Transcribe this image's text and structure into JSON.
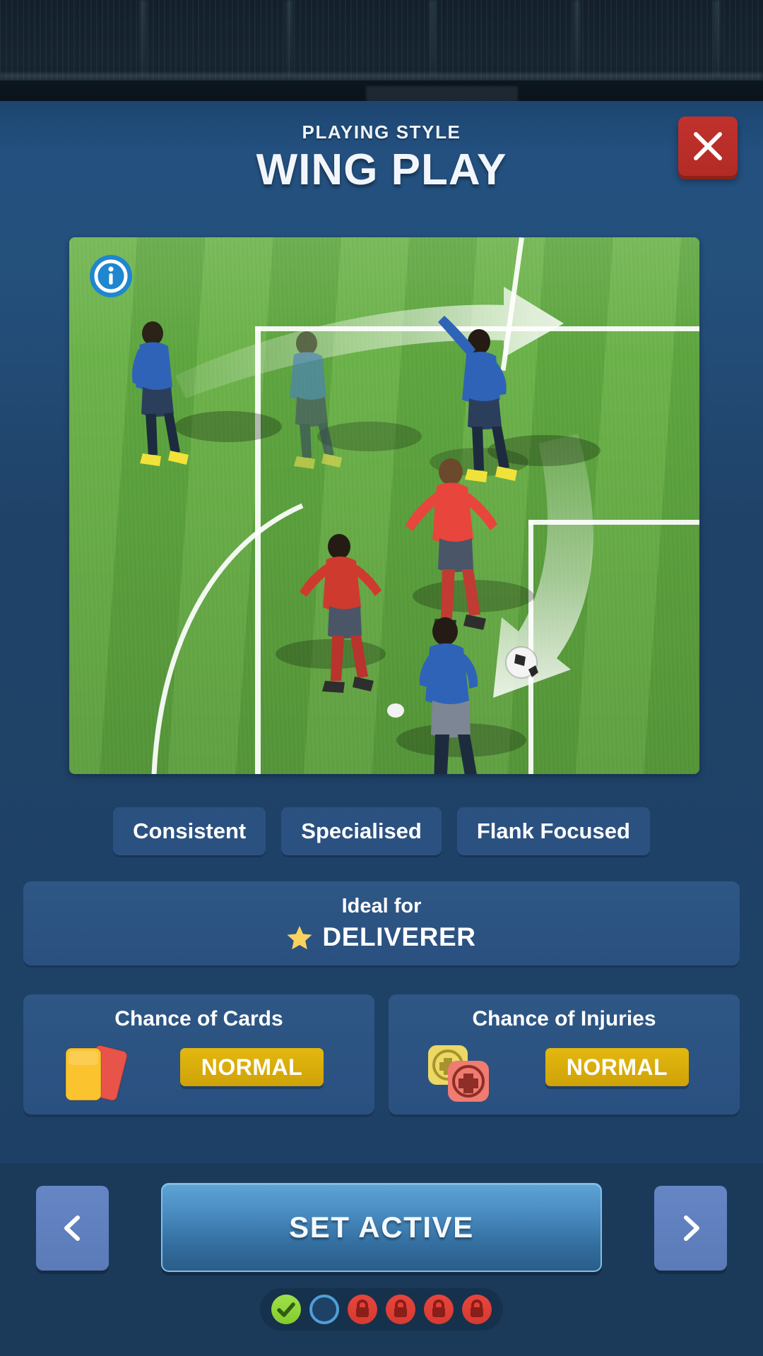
{
  "header": {
    "kicker": "PLAYING STYLE",
    "title": "WING PLAY",
    "close_icon": "close-icon"
  },
  "preview": {
    "info_icon": "info-icon",
    "alt": "wing play tactic pitch animation"
  },
  "tags": [
    {
      "label": "Consistent"
    },
    {
      "label": "Specialised"
    },
    {
      "label": "Flank Focused"
    }
  ],
  "ideal_for": {
    "label": "Ideal for",
    "star_icon": "star-icon",
    "role": "DELIVERER"
  },
  "stats": [
    {
      "title": "Chance of Cards",
      "icon": "cards-icon",
      "value": "NORMAL"
    },
    {
      "title": "Chance of Injuries",
      "icon": "injury-icon",
      "value": "NORMAL"
    }
  ],
  "footer": {
    "prev_icon": "chevron-left-icon",
    "next_icon": "chevron-right-icon",
    "primary_action": "SET ACTIVE",
    "pager": [
      {
        "state": "done",
        "icon": "check-icon"
      },
      {
        "state": "current",
        "icon": "ring-icon"
      },
      {
        "state": "locked",
        "icon": "lock-icon"
      },
      {
        "state": "locked",
        "icon": "lock-icon"
      },
      {
        "state": "locked",
        "icon": "lock-icon"
      },
      {
        "state": "locked",
        "icon": "lock-icon"
      }
    ]
  },
  "colors": {
    "panel_bg": "#1f4268",
    "card_bg": "#2c5382",
    "chip_bg": "#2b5180",
    "accent_gold": "#e3b80f",
    "close_red": "#c1312c",
    "primary_blue": "#4b8ec4",
    "bottom_bar": "#1b3a5a",
    "locked_red": "#e8453c",
    "done_green": "#8fd63a"
  }
}
